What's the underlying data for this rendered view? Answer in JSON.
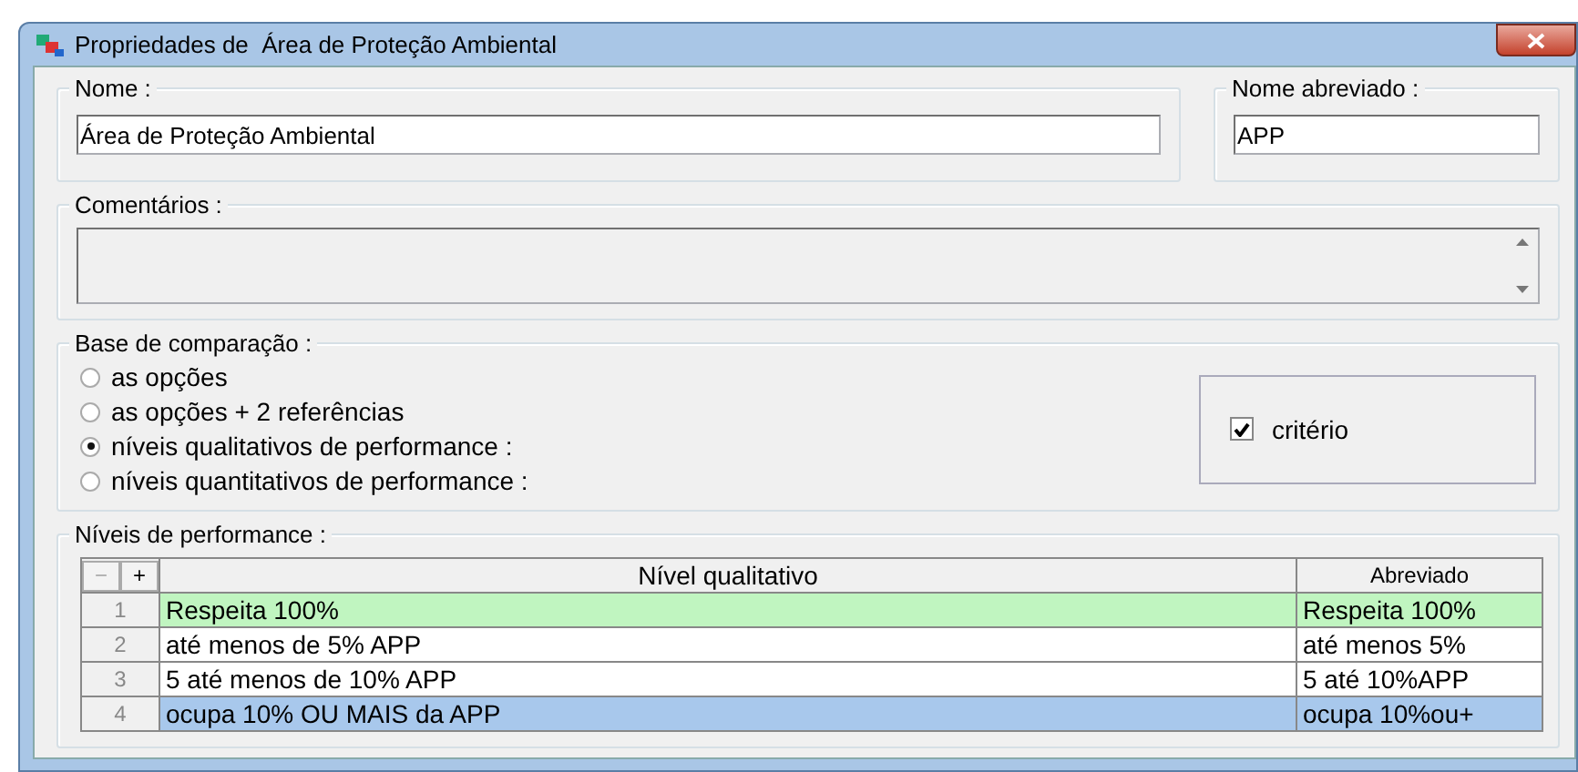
{
  "window": {
    "title": "Propriedades de  Área de Proteção Ambiental"
  },
  "nome": {
    "label": "Nome :",
    "value": "Área de Proteção Ambiental"
  },
  "nome_abreviado": {
    "label": "Nome abreviado :",
    "value": "APP"
  },
  "comentarios": {
    "label": "Comentários :"
  },
  "base_de_comparacao": {
    "label": "Base de comparação :",
    "options": [
      {
        "label": "as opções",
        "selected": false
      },
      {
        "label": "as opções + 2 referências",
        "selected": false
      },
      {
        "label": "níveis qualitativos de performance :",
        "selected": true
      },
      {
        "label": "níveis quantitativos de performance :",
        "selected": false
      }
    ],
    "criterio": {
      "label": "critério",
      "checked": true
    }
  },
  "niveis_de_performance": {
    "label": "Níveis de performance :",
    "buttons": [
      {
        "label": "−",
        "disabled": true
      },
      {
        "label": "+",
        "disabled": false
      }
    ],
    "columns": [
      "Nível qualitativo",
      "Abreviado"
    ],
    "rows": [
      {
        "number": "1",
        "nivel": "Respeita 100%",
        "abreviado": "Respeita 100%",
        "color": "#c0f5c0"
      },
      {
        "number": "2",
        "nivel": "até menos de 5% APP",
        "abreviado": "até menos 5%",
        "color": "#ffffff"
      },
      {
        "number": "3",
        "nivel": "5 até menos de 10% APP",
        "abreviado": "5 até 10%APP",
        "color": "#ffffff"
      },
      {
        "number": "4",
        "nivel": "ocupa 10% OU MAIS da APP",
        "abreviado": "ocupa 10%ou+",
        "color": "#a8c8ec"
      }
    ]
  }
}
